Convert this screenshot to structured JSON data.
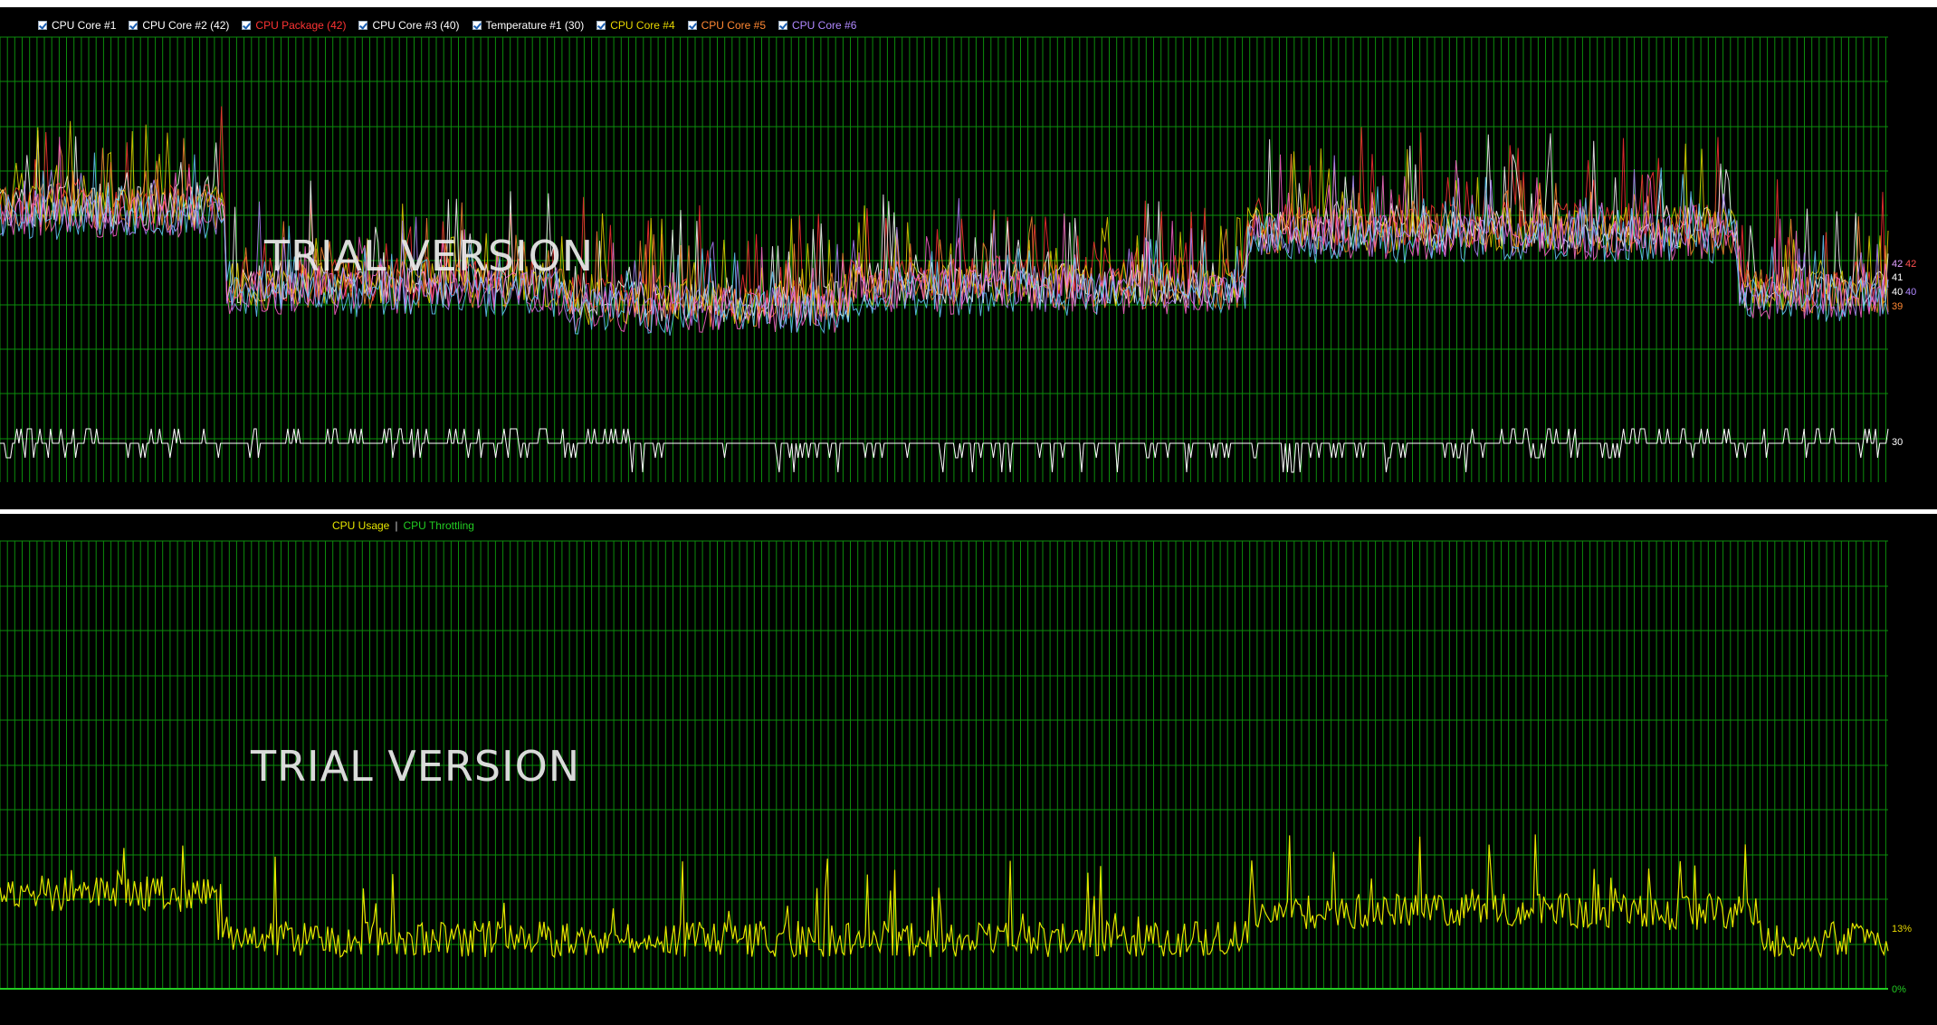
{
  "top_chart": {
    "legend": [
      {
        "label": "CPU Core #1",
        "color": "#ffffff"
      },
      {
        "label": "CPU Core #2 (42)",
        "color": "#ffffff"
      },
      {
        "label": "CPU Package (42)",
        "color": "#ff3333"
      },
      {
        "label": "CPU Core #3 (40)",
        "color": "#ffffff"
      },
      {
        "label": "Temperature #1 (30)",
        "color": "#ffffff"
      },
      {
        "label": "CPU Core #4",
        "color": "#e6d600"
      },
      {
        "label": "CPU Core #5",
        "color": "#ff8833"
      },
      {
        "label": "CPU Core #6",
        "color": "#b088ff"
      }
    ],
    "right_labels": [
      {
        "text": "42",
        "color": "#e0a0ff"
      },
      {
        "text": "42",
        "color": "#ff5050"
      },
      {
        "text": "41",
        "color": "#ffffff"
      },
      {
        "text": "40",
        "color": "#ffffff"
      },
      {
        "text": "40",
        "color": "#b088ff"
      },
      {
        "text": "39",
        "color": "#ff8833"
      },
      {
        "text": "30",
        "color": "#ffffff"
      }
    ],
    "watermark": "TRIAL VERSION"
  },
  "bottom_chart": {
    "legend_usage": "CPU Usage",
    "legend_separator": "|",
    "legend_throttling": "CPU Throttling",
    "right_labels": [
      {
        "text": "13%",
        "color": "#e6d600"
      },
      {
        "text": "0%",
        "color": "#22cc22"
      }
    ],
    "watermark": "TRIAL VERSION"
  },
  "colors": {
    "grid": "#0c8c0c",
    "usage": "#e6e600",
    "throttling": "#22cc22",
    "background": "#000000"
  },
  "chart_data": [
    {
      "type": "line",
      "title": "",
      "series": [
        {
          "name": "CPU Core #2 (42)",
          "last_value": 42
        },
        {
          "name": "CPU Package (42)",
          "last_value": 42
        },
        {
          "name": "CPU Core #3 (40)",
          "last_value": 40
        },
        {
          "name": "Temperature #1 (30)",
          "last_value": 30
        }
      ],
      "grid": true
    },
    {
      "type": "line",
      "title": "",
      "series": [
        {
          "name": "CPU Usage",
          "last_value": 13
        },
        {
          "name": "CPU Throttling",
          "last_value": 0
        }
      ],
      "grid": true
    }
  ]
}
